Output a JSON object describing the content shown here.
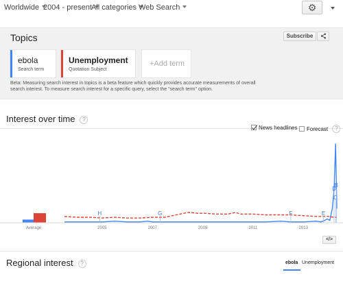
{
  "filters": {
    "region": "Worldwide",
    "timeframe": "2004 - present",
    "category": "All categories",
    "search_type": "Web Search"
  },
  "topics": {
    "title": "Topics",
    "subscribe_label": "Subscribe",
    "share_icon": "share-icon",
    "terms": [
      {
        "name": "ebola",
        "subtitle": "Search term",
        "color": "#4285f4"
      },
      {
        "name": "Unemployment",
        "subtitle": "Quotation Subject",
        "color": "#db4437"
      }
    ],
    "add_term_label": "+Add term",
    "beta_note": "Beta: Measuring search interest in topics is a beta feature which quickly provides accurate measurements of overall search interest. To measure search interest for a specific query, select the \"search term\" option."
  },
  "interest_over_time": {
    "title": "Interest over time",
    "help_label": "?",
    "news_headlines_label": "News headlines",
    "news_headlines_checked": true,
    "forecast_label": "Forecast",
    "forecast_checked": false,
    "embed_label": "</>"
  },
  "chart_data": {
    "type": "line",
    "x_ticks": [
      "2005",
      "2007",
      "2009",
      "2011",
      "2013"
    ],
    "average_label": "Average",
    "ylim": [
      0,
      100
    ],
    "average_bars": [
      {
        "term": "ebola",
        "value": 2,
        "color": "#4285f4"
      },
      {
        "term": "Unemployment",
        "value": 8,
        "color": "#db4437"
      }
    ],
    "series": [
      {
        "name": "ebola",
        "color": "#4285f4",
        "style": "solid",
        "x": [
          2004.0,
          2005.0,
          2005.5,
          2006.0,
          2006.5,
          2007.0,
          2007.3,
          2007.5,
          2008.0,
          2009.0,
          2010.0,
          2011.0,
          2012.0,
          2012.6,
          2013.0,
          2013.5,
          2014.0,
          2014.2,
          2014.35,
          2014.45,
          2014.55,
          2014.65,
          2014.72,
          2014.78,
          2014.83
        ],
        "values": [
          1,
          1,
          1,
          2,
          1,
          1,
          2,
          1,
          1,
          1,
          1,
          1,
          1,
          2,
          1,
          1,
          2,
          1,
          3,
          5,
          3,
          18,
          42,
          100,
          18
        ]
      },
      {
        "name": "Unemployment",
        "color": "#db4437",
        "style": "dashed",
        "x": [
          2004.0,
          2004.5,
          2005.0,
          2005.5,
          2006.0,
          2006.5,
          2007.0,
          2007.5,
          2008.0,
          2008.3,
          2008.6,
          2008.9,
          2009.0,
          2009.3,
          2009.6,
          2010.0,
          2010.5,
          2010.8,
          2011.0,
          2011.5,
          2012.0,
          2012.5,
          2013.0,
          2013.5,
          2014.0,
          2014.3,
          2014.5,
          2014.7,
          2014.83
        ],
        "values": [
          8,
          7,
          7,
          6,
          7,
          6,
          6,
          7,
          7,
          9,
          11,
          13,
          13,
          12,
          12,
          11,
          11,
          13,
          11,
          11,
          10,
          10,
          10,
          9,
          8,
          8,
          8,
          7,
          7
        ]
      }
    ],
    "markers": [
      {
        "label": "H",
        "x": 2005.4
      },
      {
        "label": "G",
        "x": 2007.8
      },
      {
        "label": "F",
        "x": 2013.0
      },
      {
        "label": "E",
        "x": 2014.3
      },
      {
        "label": "D",
        "x": 2014.72
      },
      {
        "label": "C",
        "x": 2014.78
      },
      {
        "label": "B",
        "x": 2014.81
      }
    ]
  },
  "regional_interest": {
    "title": "Regional interest",
    "help_label": "?",
    "tabs": [
      "ebola",
      "Unemployment"
    ]
  }
}
